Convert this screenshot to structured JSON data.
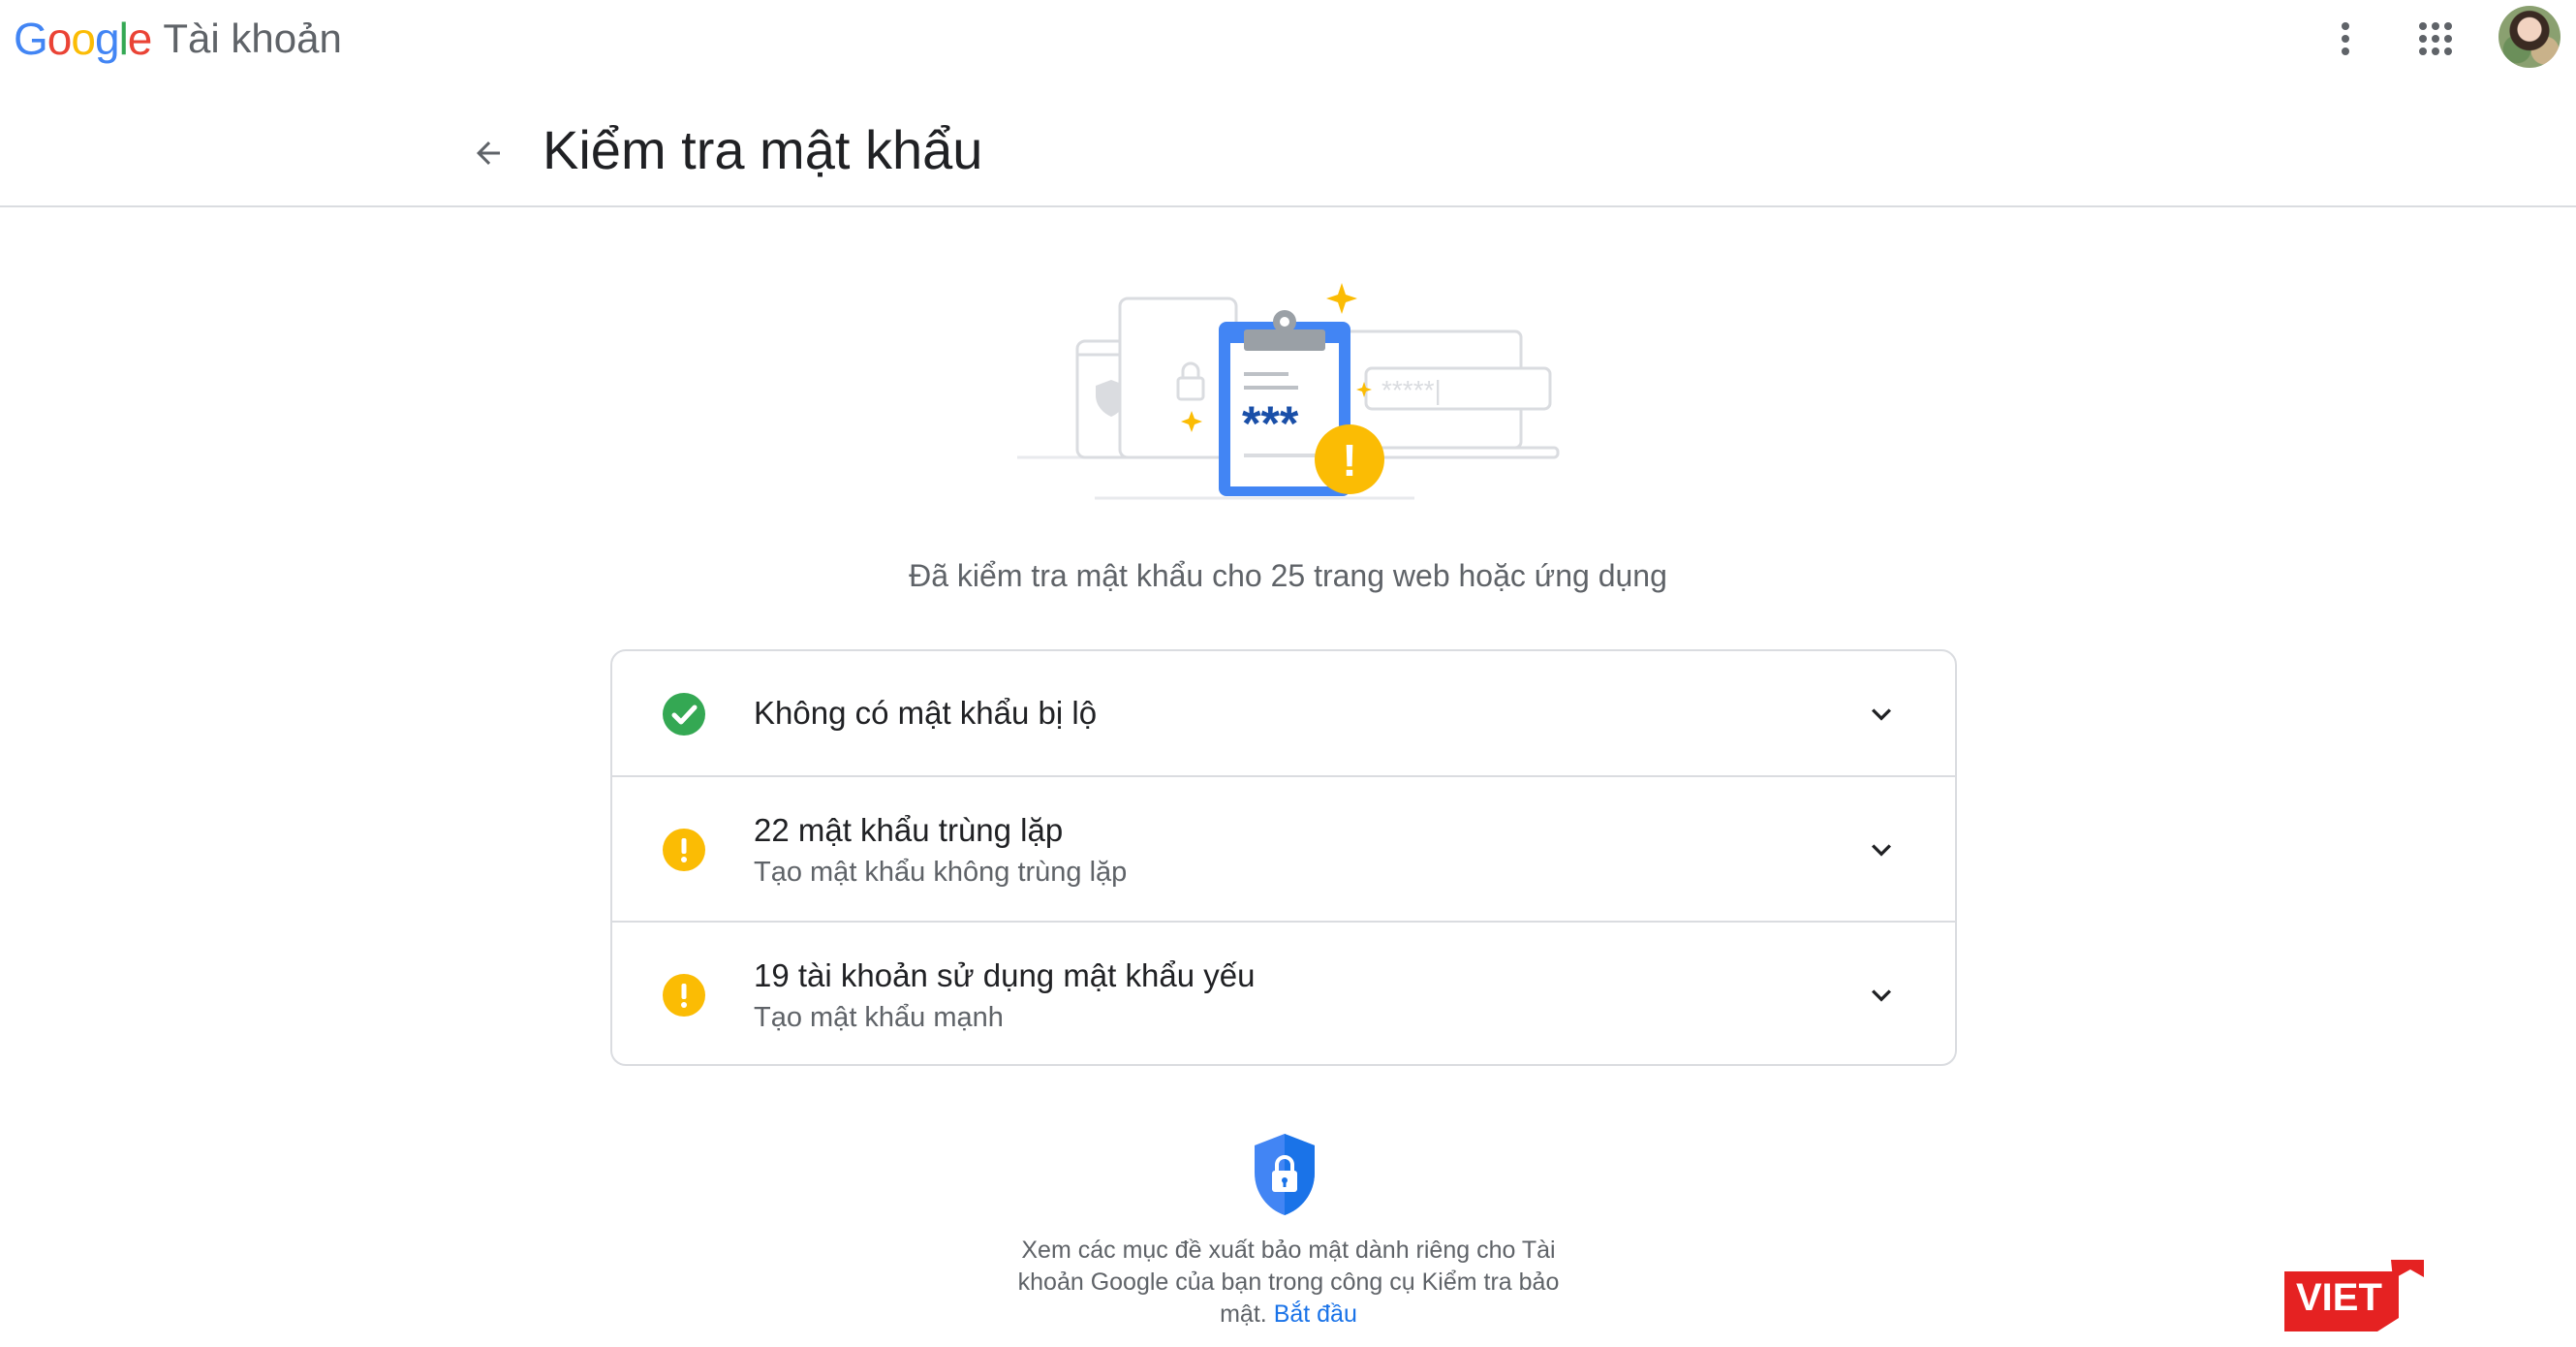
{
  "topbar": {
    "logo_letters": [
      "G",
      "o",
      "o",
      "g",
      "l",
      "e"
    ],
    "product_name": "Tài khoản",
    "icons": [
      "more-vert-icon",
      "apps-grid-icon",
      "avatar"
    ]
  },
  "header": {
    "back_icon": "arrow-back-icon",
    "title": "Kiểm tra mật khẩu"
  },
  "illustration": {
    "password_mask": "***",
    "field_mask": "*****|",
    "alert_mark": "!"
  },
  "summary": "Đã kiểm tra mật khẩu cho 25 trang web hoặc ứng dụng",
  "results": [
    {
      "status": "ok",
      "title": "Không có mật khẩu bị lộ",
      "subtitle": ""
    },
    {
      "status": "warning",
      "title": "22 mật khẩu trùng lặp",
      "subtitle": "Tạo mật khẩu không trùng lặp"
    },
    {
      "status": "warning",
      "title": "19 tài khoản sử dụng mật khẩu yếu",
      "subtitle": "Tạo mật khẩu mạnh"
    }
  ],
  "footer": {
    "text": "Xem các mục đề xuất bảo mật dành riêng cho Tài khoản Google của bạn trong công cụ Kiểm tra bảo mật.",
    "link_label": "Bắt đầu"
  },
  "watermark": "VIET",
  "colors": {
    "ok": "#34a853",
    "warning": "#fbbc04",
    "link": "#1a73e8",
    "clipboard_blue": "#4285f4",
    "watermark_red": "#e52222"
  }
}
